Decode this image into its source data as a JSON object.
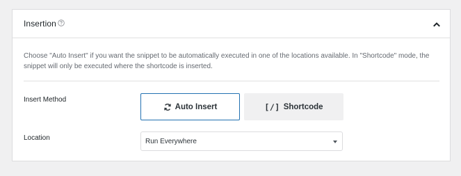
{
  "panel": {
    "title": "Insertion",
    "help_icon": "question-circle-icon",
    "collapse_icon": "chevron-up-icon",
    "description": "Choose \"Auto Insert\" if you want the snippet to be automatically executed in one of the locations available. In \"Shortcode\" mode, the snippet will only be executed where the shortcode is inserted."
  },
  "insert_method": {
    "label": "Insert Method",
    "options": [
      {
        "label": "Auto Insert",
        "icon": "refresh-icon",
        "selected": true
      },
      {
        "label": "Shortcode",
        "icon": "shortcode-icon",
        "icon_text": "[/]",
        "selected": false
      }
    ]
  },
  "location": {
    "label": "Location",
    "selected_value": "Run Everywhere"
  },
  "colors": {
    "accent": "#2271b1",
    "text": "#1d2327",
    "muted_text": "#646970",
    "background": "#f0f0f1"
  }
}
